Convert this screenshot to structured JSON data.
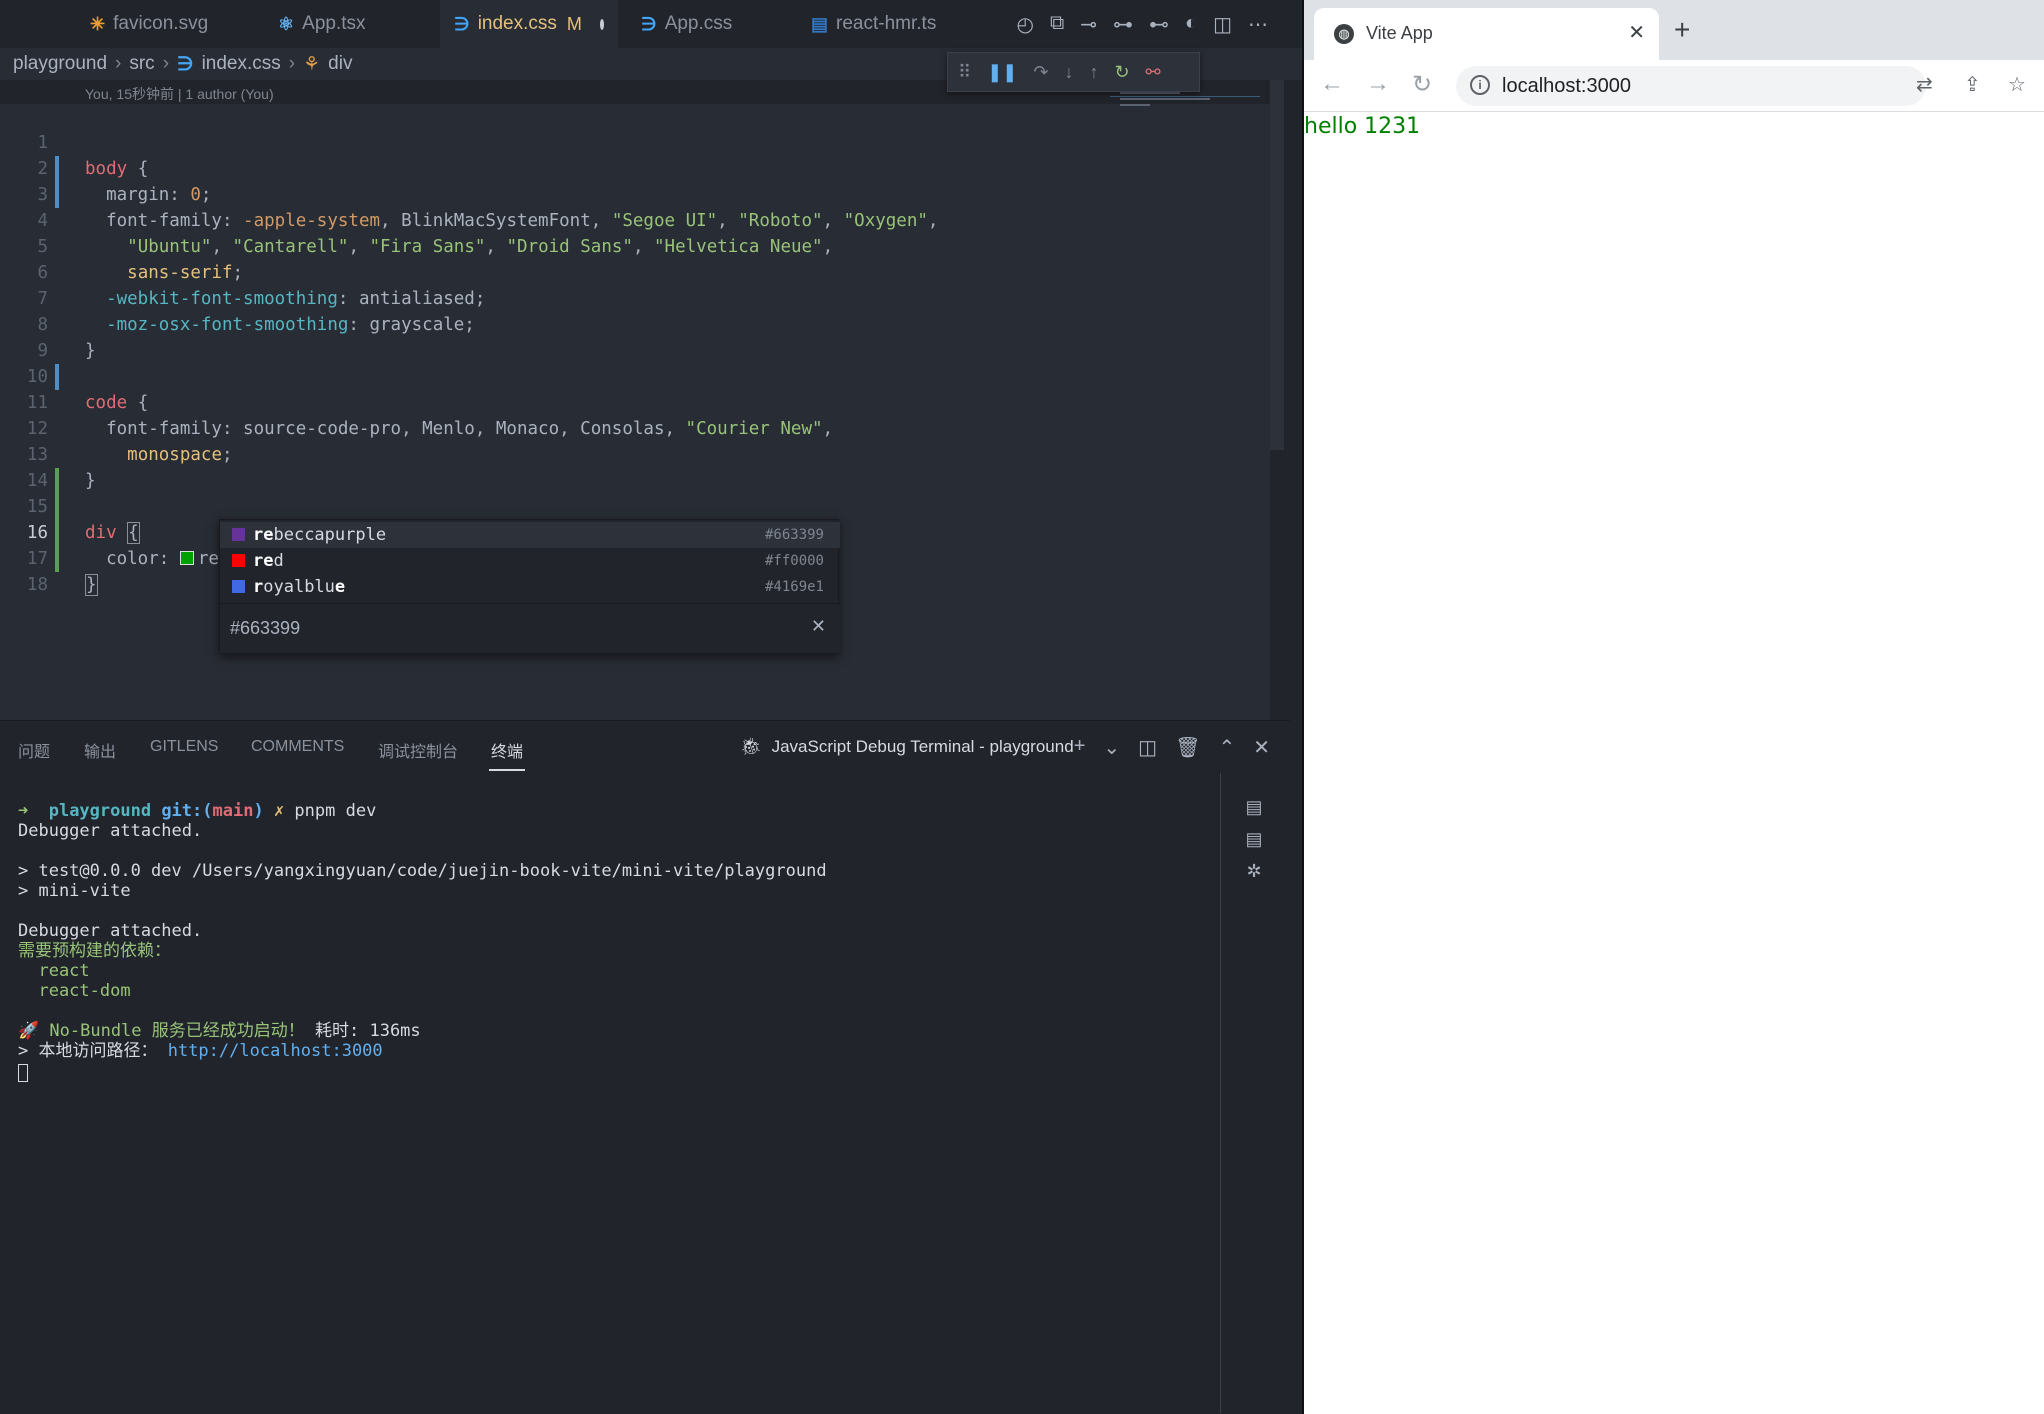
{
  "editor": {
    "tabs": [
      {
        "label": "favicon.svg",
        "icon": "svg-star-icon",
        "color": "#f0a030"
      },
      {
        "label": "App.tsx",
        "icon": "react-icon",
        "color": "#61afef"
      },
      {
        "label": "index.css",
        "modified": "M",
        "icon": "css-icon",
        "color": "#42a5f5"
      },
      {
        "label": "App.css",
        "icon": "css-icon",
        "color": "#42a5f5"
      },
      {
        "label": "react-hmr.ts",
        "icon": "ts-icon",
        "color": "#3178c6"
      }
    ],
    "breadcrumb": [
      "playground",
      "src",
      "index.css",
      "div"
    ],
    "blame": "You, 15秒钟前 | 1 author (You)",
    "lines": [
      "1",
      "2",
      "3",
      "4",
      "5",
      "6",
      "7",
      "8",
      "9",
      "10",
      "11",
      "12",
      "13",
      "14",
      "15",
      "16",
      "17",
      "18"
    ],
    "code": {
      "l1_sel": "body",
      "l1_rest": " {",
      "l2_prop": "  margin: ",
      "l2_num": "0",
      "l2_end": ";",
      "l3_prop": "  font-family: ",
      "l3_v1": "-apple-system",
      "l3_v2": ", BlinkMacSystemFont, ",
      "l3_s1": "\"Segoe UI\"",
      "l3_c1": ", ",
      "l3_s2": "\"Roboto\"",
      "l3_c2": ", ",
      "l3_s3": "\"Oxygen\"",
      "l3_c3": ",",
      "l4_ind": "    ",
      "l4_s1": "\"Ubuntu\"",
      "l4_c1": ", ",
      "l4_s2": "\"Cantarell\"",
      "l4_c2": ", ",
      "l4_s3": "\"Fira Sans\"",
      "l4_c3": ", ",
      "l4_s4": "\"Droid Sans\"",
      "l4_c4": ", ",
      "l4_s5": "\"Helvetica Neue\"",
      "l4_c5": ",",
      "l5_ind": "    ",
      "l5_kw": "sans-serif",
      "l5_end": ";",
      "l6_prop": "  -webkit-font-smoothing",
      "l6_rest": ": antialiased;",
      "l7_prop": "  -moz-osx-font-smoothing",
      "l7_rest": ": grayscale;",
      "l8": "}",
      "l10_sel": "code",
      "l10_rest": " {",
      "l11_prop": "  font-family: source-code-pro, Menlo, Monaco, Consolas, ",
      "l11_str": "\"Courier New\"",
      "l11_end": ",",
      "l12_ind": "    ",
      "l12_kw": "monospace",
      "l12_end": ";",
      "l13": "}",
      "l15_sel": "div",
      "l15_sp": " ",
      "l15_brace": "{",
      "l16_prop": "  color: ",
      "l16_val": "re",
      "l16_end": ";",
      "l17": "}"
    },
    "suggestions": [
      {
        "bold": "re",
        "rest": "beccapurple",
        "hex": "#663399",
        "swatch": "#663399"
      },
      {
        "bold": "re",
        "rest": "d",
        "hex": "#ff0000",
        "swatch": "#ff0000"
      },
      {
        "bold": "r",
        "mid": "oyalblu",
        "bold2": "e",
        "hex": "#4169e1",
        "swatch": "#4169e1"
      }
    ],
    "suggestion_detail": "#663399",
    "panel": {
      "tabs": [
        "问题",
        "输出",
        "GITLENS",
        "COMMENTS",
        "调试控制台",
        "终端"
      ],
      "active_tab": "终端",
      "terminal_title": "JavaScript Debug Terminal - playground"
    },
    "terminal": {
      "l1_arrow": "➜ ",
      "l1_dir": " playground",
      "l1_git": " git:(",
      "l1_branch": "main",
      "l1_close": ")",
      "l1_x": " ✗",
      "l1_cmd": " pnpm dev",
      "l2": "Debugger attached.",
      "l4": "> test@0.0.0 dev /Users/yangxingyuan/code/juejin-book-vite/mini-vite/playground",
      "l5": "> mini-vite",
      "l7": "Debugger attached.",
      "l8": "需要预构建的依赖：",
      "l9": "  react",
      "l10": "  react-dom",
      "l12_rocket": "🚀 ",
      "l12_msg": "No-Bundle 服务已经成功启动！",
      "l12_time": " 耗时: 136ms",
      "l13_label": "> 本地访问路径： ",
      "l13_url": "http://localhost:3000"
    }
  },
  "browser": {
    "tab_title": "Vite App",
    "url": "localhost:3000",
    "content_text": "hello 1231",
    "content_color": "#008000"
  }
}
